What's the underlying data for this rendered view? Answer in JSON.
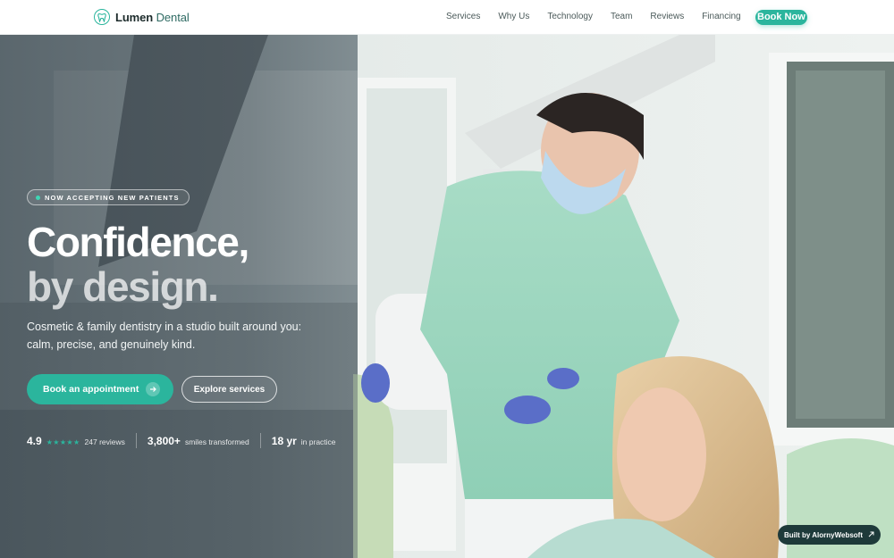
{
  "brand": {
    "name_bold": "Lumen",
    "name_light": "Dental",
    "accent_color": "#2bb59d"
  },
  "nav": {
    "links": [
      "Services",
      "Why Us",
      "Technology",
      "Team",
      "Reviews",
      "Financing"
    ],
    "cta": "Book Now"
  },
  "hero": {
    "badge": "NOW ACCEPTING NEW PATIENTS",
    "headline_line1": "Confidence,",
    "headline_line2": "by design.",
    "subtext": "Cosmetic & family dentistry in a studio built around you: calm, precise, and genuinely kind.",
    "primary_button": "Book an appointment",
    "secondary_button": "Explore services",
    "stats": [
      {
        "value": "4.9",
        "stars": "★★★★★",
        "label": "247 reviews"
      },
      {
        "value": "3,800+",
        "label": "smiles transformed"
      },
      {
        "value": "18 yr",
        "label": "in practice"
      }
    ]
  },
  "footer_badge": {
    "label": "Built by AlornyWebsoft",
    "icon": "arrow-up-right-icon"
  }
}
